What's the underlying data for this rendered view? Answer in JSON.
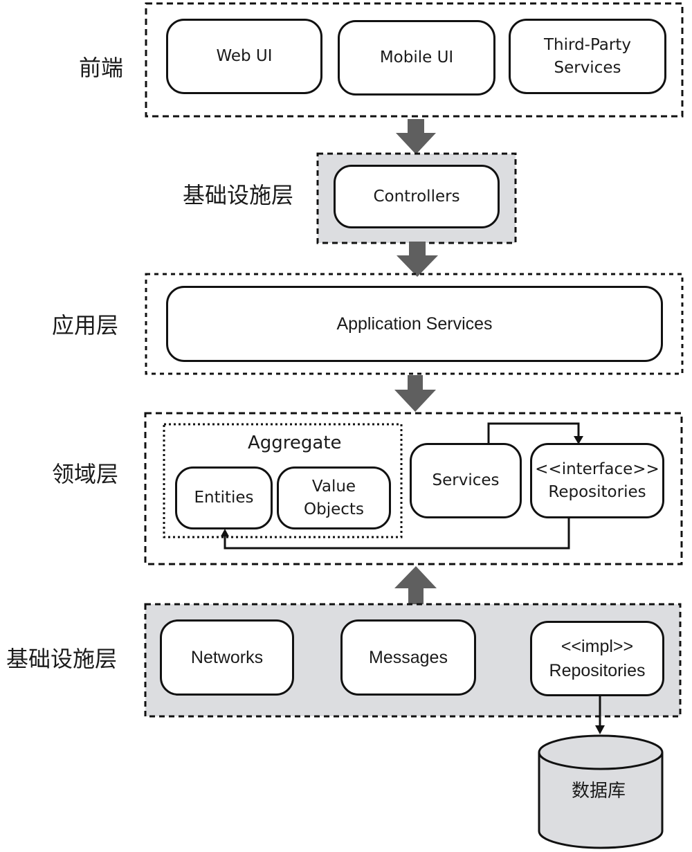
{
  "diagram": {
    "layers": {
      "frontend": {
        "label": "前端",
        "nodes": [
          {
            "lines": [
              "Web UI"
            ]
          },
          {
            "lines": [
              "Mobile UI"
            ]
          },
          {
            "lines": [
              "Third-Party",
              "Services"
            ]
          }
        ]
      },
      "infrastructure_top": {
        "label": "基础设施层",
        "nodes": [
          {
            "lines": [
              "Controllers"
            ]
          }
        ]
      },
      "application": {
        "label": "应用层",
        "nodes": [
          {
            "lines": [
              "Application Services"
            ]
          }
        ]
      },
      "domain": {
        "label": "领域层",
        "aggregate_title": "Aggregate",
        "nodes": [
          {
            "lines": [
              "Entities"
            ]
          },
          {
            "lines": [
              "Value",
              "Objects"
            ]
          },
          {
            "lines": [
              "Services"
            ]
          },
          {
            "lines": [
              "<<interface>>",
              "Repositories"
            ]
          }
        ]
      },
      "infrastructure_bottom": {
        "label": "基础设施层",
        "nodes": [
          {
            "lines": [
              "Networks"
            ]
          },
          {
            "lines": [
              "Messages"
            ]
          },
          {
            "lines": [
              "<<impl>>",
              "Repositories"
            ]
          }
        ]
      }
    },
    "database": {
      "label": "数据库"
    },
    "colors": {
      "shaded_layer": "#dcdde0",
      "arrow": "#5f5f5f",
      "line": "#111111",
      "database_fill": "#dcdde0"
    }
  }
}
